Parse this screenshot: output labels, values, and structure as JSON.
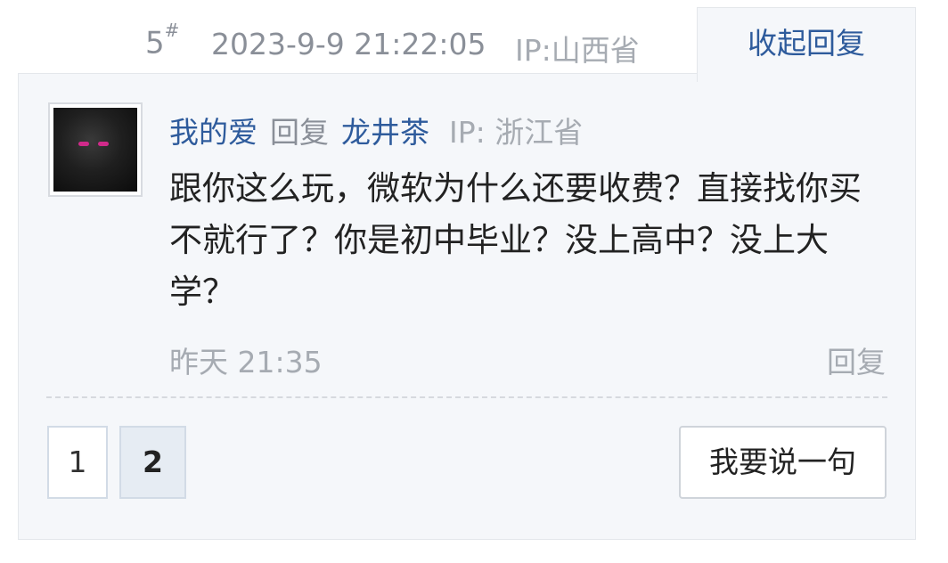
{
  "post_meta": {
    "floor_number": "5",
    "floor_mark": "#",
    "timestamp": "2023-9-9 21:22:05",
    "ip_location": "IP:山西省",
    "collapse_label": "收起回复"
  },
  "reply": {
    "author": "我的爱",
    "action": "回复",
    "target": "龙井茶",
    "ip_location": "IP: 浙江省",
    "content": "跟你这么玩，微软为什么还要收费？直接找你买不就行了？你是初中毕业？没上高中？没上大学？",
    "time": "昨天 21:35",
    "reply_label": "回复"
  },
  "pagination": {
    "pages": [
      "1",
      "2"
    ],
    "current": "2"
  },
  "actions": {
    "say_label": "我要说一句"
  },
  "colors": {
    "link": "#2e5b9c",
    "muted": "#8a8f98",
    "panel_bg": "#f5f7fa",
    "active_page_bg": "#e6ecf3"
  },
  "icons": {
    "avatar": "user-avatar"
  }
}
